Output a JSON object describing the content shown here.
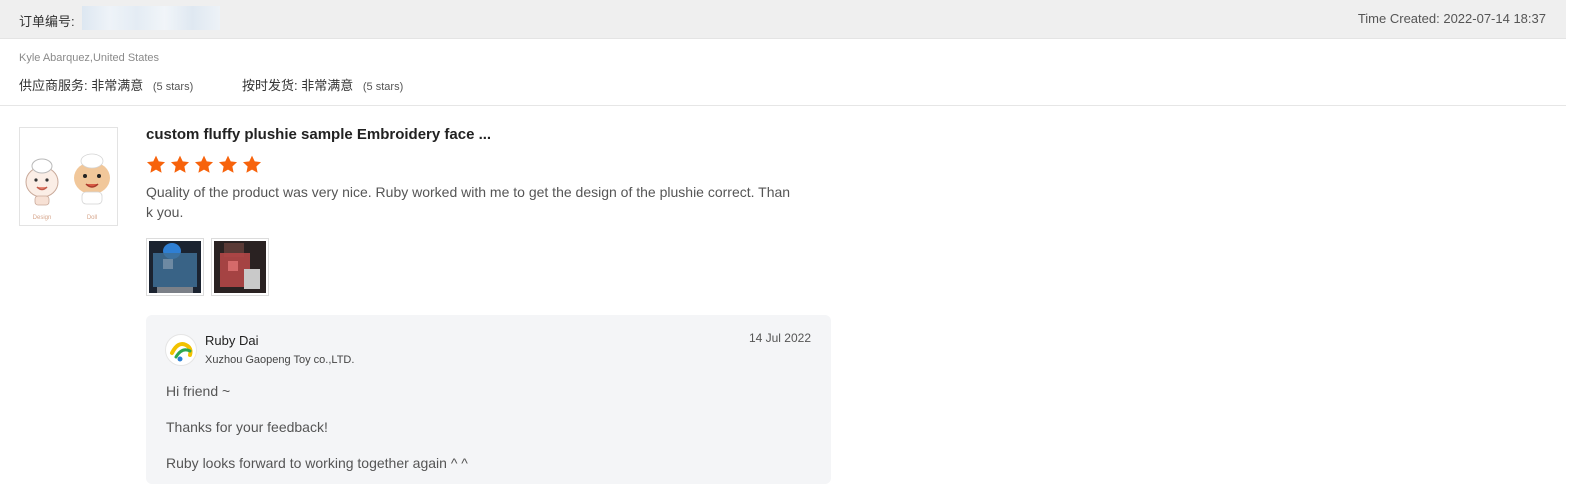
{
  "order": {
    "label": "订单编号:",
    "time_created_label": "Time Created:",
    "time_created_value": "2022-07-14 18:37"
  },
  "buyer": {
    "name_location": "Kyle Abarquez,United States",
    "ratings": [
      {
        "label": "供应商服务:",
        "value": "非常满意",
        "stars_text": "(5 stars)"
      },
      {
        "label": "按时发货:",
        "value": "非常满意",
        "stars_text": "(5 stars)"
      }
    ]
  },
  "review": {
    "product_title": "custom fluffy plushie sample Embroidery face ...",
    "star_rating": 5,
    "star_color": "#f7630c",
    "text": "Quality of the product was very nice. Ruby worked with me to get the design of the plushie correct. Thank you.",
    "photo_count": 2,
    "product_image_captions": [
      "Design",
      "Doll"
    ]
  },
  "reply": {
    "seller_name": "Ruby Dai",
    "company": "Xuzhou Gaopeng Toy co.,LTD.",
    "date": "14 Jul 2022",
    "lines": [
      "Hi friend ~",
      "Thanks for your feedback!",
      "Ruby looks forward to working together again ^ ^"
    ]
  }
}
